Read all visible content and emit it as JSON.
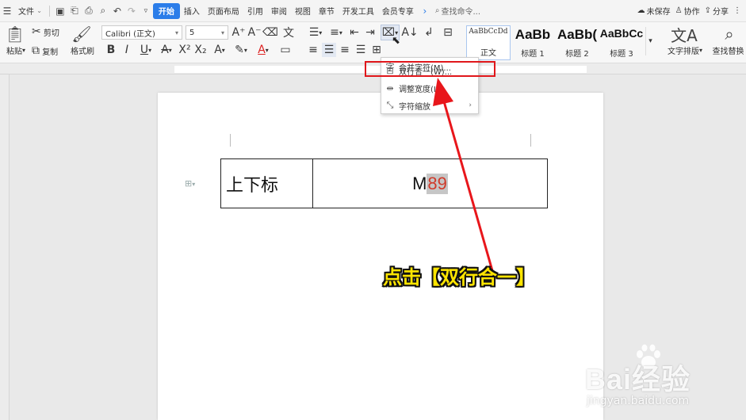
{
  "menubar": {
    "file_label": "文件",
    "tabs": [
      {
        "label": "开始",
        "active": true
      },
      {
        "label": "插入",
        "active": false
      },
      {
        "label": "页面布局",
        "active": false
      },
      {
        "label": "引用",
        "active": false
      },
      {
        "label": "审阅",
        "active": false
      },
      {
        "label": "视图",
        "active": false
      },
      {
        "label": "章节",
        "active": false
      },
      {
        "label": "开发工具",
        "active": false
      },
      {
        "label": "会员专享",
        "active": false
      }
    ],
    "search_label": "查找命令...",
    "unsaved_label": "未保存",
    "collab_label": "协作",
    "share_label": "分享"
  },
  "ribbon": {
    "paste_label": "粘贴",
    "cut_label": "剪切",
    "copy_label": "复制",
    "format_painter_label": "格式刷",
    "font_name": "Calibri (正文)",
    "font_size": "5",
    "styles": [
      {
        "sample": "AaBbCcDd",
        "label": "正文"
      },
      {
        "sample": "AaBb",
        "label": "标题 1"
      },
      {
        "sample": "AaBb(",
        "label": "标题 2"
      },
      {
        "sample": "AaBbCc",
        "label": "标题 3"
      }
    ],
    "text_layout_label": "文字排版",
    "find_replace_label": "查找替换"
  },
  "dropdown": {
    "items": [
      {
        "label": "合并字符(M)..."
      },
      {
        "label": "双行合一(W)..."
      },
      {
        "label": "调整宽度(I)..."
      },
      {
        "label": "字符缩放"
      }
    ]
  },
  "document": {
    "cell_a": "上下标",
    "cell_b_prefix": "M",
    "cell_b_selected": "89"
  },
  "annotation": {
    "callout": "点击【双行合一】"
  },
  "colors": {
    "accent": "#2b7de9",
    "highlight_box": "#e0171b",
    "callout": "#ffe500",
    "selected_text": "#d03a2a"
  },
  "watermark": {
    "brand": "Bai经验",
    "url": "jingyan.baidu.com"
  }
}
